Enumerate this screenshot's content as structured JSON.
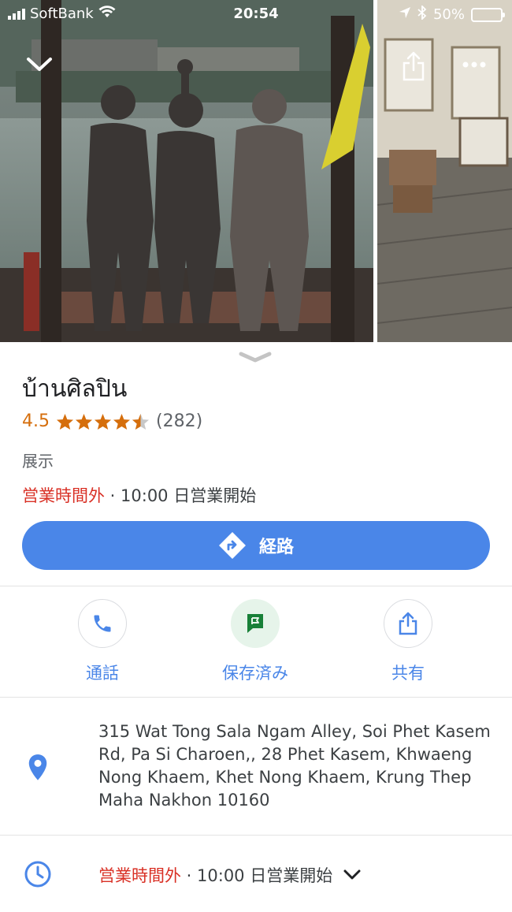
{
  "status_bar": {
    "carrier": "SoftBank",
    "time": "20:54",
    "battery": "50%"
  },
  "place": {
    "name": "บ้านศิลปิน",
    "rating": "4.5",
    "rating_value": 4.5,
    "review_count": "(282)",
    "category": "展示",
    "status_closed": "営業時間外",
    "hours_note": " · 10:00 日営業開始"
  },
  "directions_button": {
    "label": "経路"
  },
  "actions": {
    "call": "通話",
    "saved": "保存済み",
    "share": "共有"
  },
  "address": "315 Wat Tong Sala Ngam Alley, Soi Phet Kasem Rd, Pa Si Charoen,, 28 Phet Kasem, Khwaeng Nong Khaem, Khet Nong Khaem, Krung Thep Maha Nakhon 10160",
  "hours_row": {
    "status_closed": "営業時間外",
    "note": " · 10:00 日営業開始"
  },
  "colors": {
    "accent": "#4a86e8",
    "rating": "#d56e0c",
    "closed": "#d93025",
    "saved": "#188038"
  }
}
